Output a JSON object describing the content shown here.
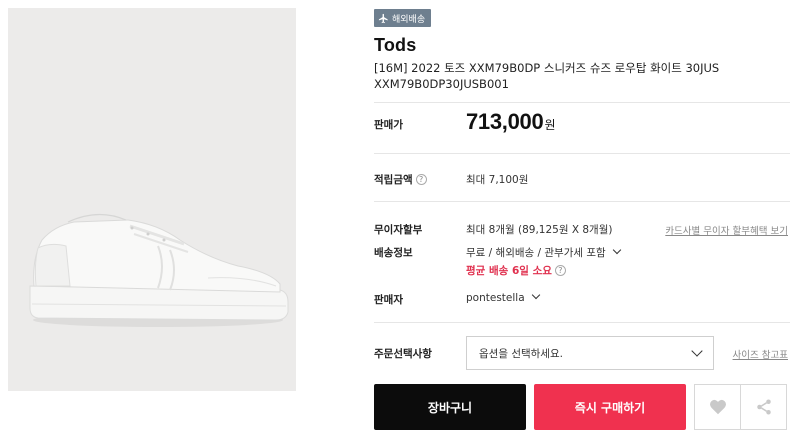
{
  "badge": {
    "label": "해외배송",
    "icon": "airplane-icon"
  },
  "product": {
    "brand": "Tods",
    "name_line1": "[16M] 2022 토즈 XXM79B0DP 스니커즈 슈즈 로우탑 화이트 30JUS",
    "name_line2": "XXM79B0DP30JUSB001"
  },
  "price": {
    "label": "판매가",
    "amount": "713,000",
    "unit": "원"
  },
  "points": {
    "label": "적립금액",
    "help": "?",
    "value": "최대 7,100원"
  },
  "installment": {
    "label": "무이자할부",
    "value": "최대 8개월 (89,125원 X 8개월)",
    "link": "카드사별 무이자 할부혜택 보기"
  },
  "shipping": {
    "label": "배송정보",
    "value": "무료 / 해외배송 / 관부가세 포함",
    "eta": "평균 배송 6일 소요",
    "help": "?"
  },
  "seller": {
    "label": "판매자",
    "value": "pontestella"
  },
  "order_option": {
    "label": "주문선택사항",
    "placeholder": "옵션을 선택하세요.",
    "size_guide": "사이즈 참고표"
  },
  "actions": {
    "cart": "장바구니",
    "buy": "즉시 구매하기",
    "like_icon": "heart-icon",
    "share_icon": "share-icon"
  },
  "colors": {
    "buy": "#f0314f",
    "cart": "#0c0c0c",
    "badge": "#6e7f8f",
    "eta": "#e0304e"
  }
}
